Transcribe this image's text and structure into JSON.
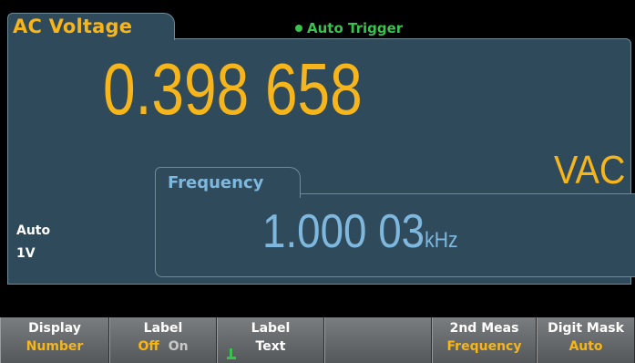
{
  "header": {
    "function_title": "AC Voltage",
    "trigger_status": "Auto Trigger"
  },
  "primary": {
    "value": "0.398 658",
    "unit": "VAC"
  },
  "range": {
    "mode": "Auto",
    "value": "1V"
  },
  "secondary": {
    "title": "Frequency",
    "value": "1.000 03",
    "unit": "kHz"
  },
  "softkeys": [
    {
      "top": "Display",
      "bottom": "Number"
    },
    {
      "top": "Label",
      "bottom_off": "Off",
      "bottom_on": "On"
    },
    {
      "top": "Label",
      "bottom": "Text"
    },
    {
      "top": "",
      "bottom": ""
    },
    {
      "top": "2nd Meas",
      "bottom": "Frequency"
    },
    {
      "top": "Digit Mask",
      "bottom": "Auto"
    }
  ],
  "colors": {
    "accent": "#f5b51b",
    "secondary": "#7fb8de",
    "panel": "#2f4a5a",
    "trigger": "#39c24d"
  },
  "icons": {
    "trigger_dot": "status-dot-icon",
    "text_entry": "text-entry-icon"
  }
}
